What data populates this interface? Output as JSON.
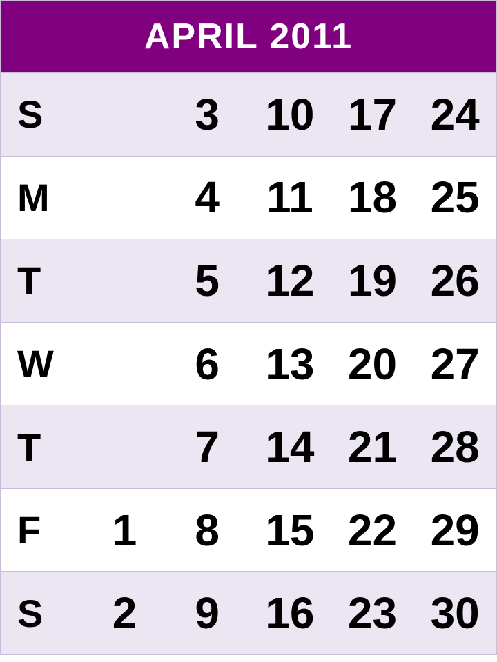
{
  "header": {
    "title": "APRIL  2011"
  },
  "colors": {
    "accent": "#800080",
    "shaded": "#ebe6f2",
    "lines": "#c9bcd8"
  },
  "rows": [
    {
      "label": "S",
      "shaded": true,
      "cells": [
        "",
        "3",
        "10",
        "17",
        "24"
      ]
    },
    {
      "label": "M",
      "shaded": false,
      "cells": [
        "",
        "4",
        "11",
        "18",
        "25"
      ]
    },
    {
      "label": "T",
      "shaded": true,
      "cells": [
        "",
        "5",
        "12",
        "19",
        "26"
      ]
    },
    {
      "label": "W",
      "shaded": false,
      "cells": [
        "",
        "6",
        "13",
        "20",
        "27"
      ]
    },
    {
      "label": "T",
      "shaded": true,
      "cells": [
        "",
        "7",
        "14",
        "21",
        "28"
      ]
    },
    {
      "label": "F",
      "shaded": false,
      "cells": [
        "1",
        "8",
        "15",
        "22",
        "29"
      ]
    },
    {
      "label": "S",
      "shaded": true,
      "cells": [
        "2",
        "9",
        "16",
        "23",
        "30"
      ]
    }
  ]
}
